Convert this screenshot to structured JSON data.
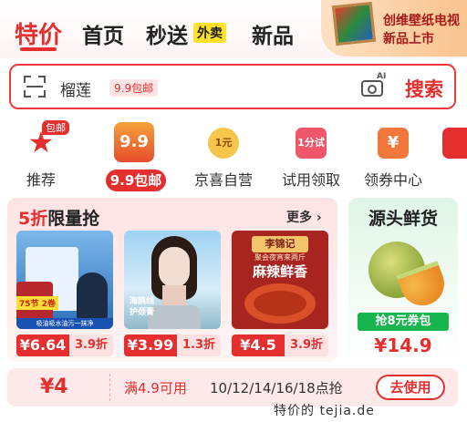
{
  "topnav": {
    "tabs": [
      "特价",
      "首页",
      "秒送",
      "新品"
    ],
    "waimai_tag": "外卖",
    "promo": {
      "line1": "创维壁纸电视",
      "line2": "新品上市"
    }
  },
  "search": {
    "keyword": "榴莲",
    "badge": "9.9包邮",
    "ai_label": "AI",
    "button": "搜索"
  },
  "categories": [
    {
      "label": "推荐",
      "badge": "包邮"
    },
    {
      "label": "9.9包邮",
      "icon_text": "9.9"
    },
    {
      "label": "京喜自营",
      "icon_text": "1元"
    },
    {
      "label": "试用领取",
      "icon_text": "1分试"
    },
    {
      "label": "领券中心",
      "icon_text": "¥"
    }
  ],
  "flash_sale": {
    "title_red": "5折",
    "title_rest": "限量抢",
    "more": "更多 ›",
    "products": [
      {
        "price": "¥6.64",
        "discount": "3.9折",
        "tag": "75节 2卷",
        "caption": "吸油吸水油污一抹净"
      },
      {
        "price": "¥3.99",
        "discount": "1.3折",
        "caption1": "海鸥线",
        "caption2": "护颈膏"
      },
      {
        "price": "¥4.5",
        "discount": "3.9折",
        "brand": "李锦记",
        "sub": "聚会夜宵来两斤",
        "big": "麻辣鲜香"
      }
    ]
  },
  "fresh": {
    "title": "源头鲜货",
    "coupon": "抢8元券包",
    "price": "¥14.9"
  },
  "coupon_strip": {
    "amount": "¥4",
    "condition": "满4.9可用",
    "times": "10/12/14/16/18点抢",
    "button": "去使用"
  },
  "watermark": "特价的 tejia.de"
}
